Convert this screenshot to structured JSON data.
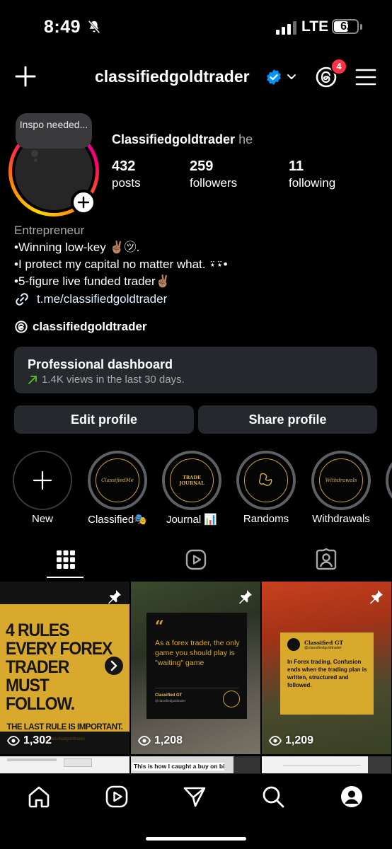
{
  "status": {
    "time": "8:49",
    "network": "LTE",
    "battery": "62",
    "battery_level": 0.62
  },
  "header": {
    "username": "classifiedgoldtrader",
    "threads_badge": "4"
  },
  "profile": {
    "note": "Inspo needed...",
    "display_name": "Classifiedgoldtrader",
    "pronouns": "he",
    "stats": [
      {
        "value": "432",
        "label": "posts"
      },
      {
        "value": "259",
        "label": "followers"
      },
      {
        "value": "11",
        "label": "following"
      }
    ],
    "category": "Entrepreneur",
    "bio_lines": [
      "•Winning low-key ✌🏽㋡.",
      "•I protect my capital no matter what. ⍣⍣•",
      "•5-figure live funded trader✌🏽"
    ],
    "link": "t.me/classifiedgoldtrader",
    "threads_handle": "classifiedgoldtrader"
  },
  "dashboard": {
    "title": "Professional dashboard",
    "subtitle": "1.4K views in the last 30 days."
  },
  "buttons": {
    "edit": "Edit profile",
    "share": "Share profile"
  },
  "highlights": [
    {
      "label": "New",
      "cover": "+"
    },
    {
      "label": "Classified🎭",
      "cover": "ClassifiedMe"
    },
    {
      "label": "Journal 📊",
      "cover": "TRADE JOURNAL"
    },
    {
      "label": "Randoms",
      "cover": ""
    },
    {
      "label": "Withdrawals",
      "cover": "Withdrawals"
    }
  ],
  "tabs": [
    "grid-icon",
    "reels-icon",
    "tagged-icon"
  ],
  "posts": [
    {
      "views": "1,302",
      "headline": "4 RULES EVERY FOREX TRADER MUST FOLLOW.",
      "sub": "THE LAST RULE IS IMPORTANT.",
      "handle": "@classifiedgoldtrader"
    },
    {
      "views": "1,208",
      "quote_mark": "“",
      "quote": "As a forex trader, the only game you should play is \"waiting\" game",
      "brand": "Classified GT",
      "handle": "@classifiedgoldtrader"
    },
    {
      "views": "1,209",
      "brand": "Classified GT",
      "handle": "@classifiedgoldtrader",
      "text": "In Forex trading, Confusion ends when the trading plan is written, structured and followed."
    }
  ],
  "row2_caption": "This is how I caught a buy on bitcoin",
  "colors": {
    "accent_link": "#e0f1ff",
    "card": "#25292e",
    "gold": "#d9a92e",
    "badge": "#ff3040",
    "verified": "#0095f6"
  }
}
